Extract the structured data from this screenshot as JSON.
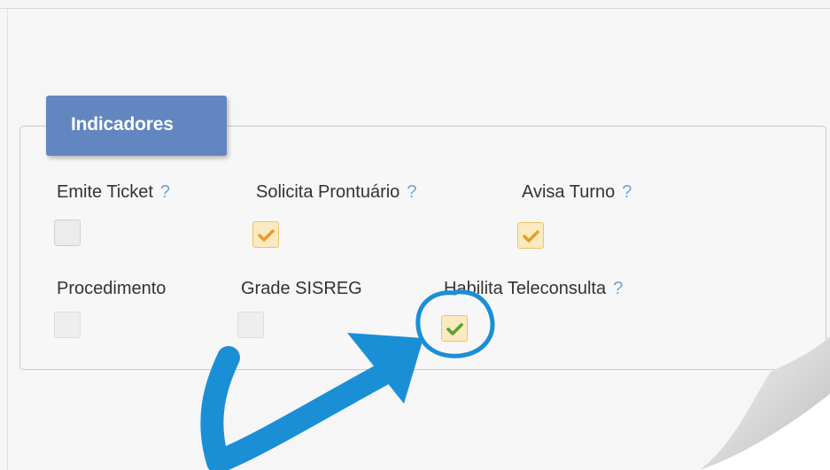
{
  "section": {
    "title": "Indicadores"
  },
  "fields": {
    "emite_ticket": {
      "label": "Emite Ticket",
      "help": "?",
      "checked": false
    },
    "solicita_prontuario": {
      "label": "Solicita Prontuário",
      "help": "?",
      "checked": true
    },
    "avisa_turno": {
      "label": "Avisa Turno",
      "help": "?",
      "checked": true
    },
    "procedimento": {
      "label": "Procedimento",
      "checked": false
    },
    "grade_sisreg": {
      "label": "Grade SISREG",
      "checked": false
    },
    "habilita_teleconsulta": {
      "label": "Habilita Teleconsulta",
      "help": "?",
      "checked": true
    }
  },
  "colors": {
    "legend": "#6286bf",
    "check_orange": "#e89a2a",
    "check_green": "#5aa12e",
    "annotation": "#1a8fd6"
  }
}
